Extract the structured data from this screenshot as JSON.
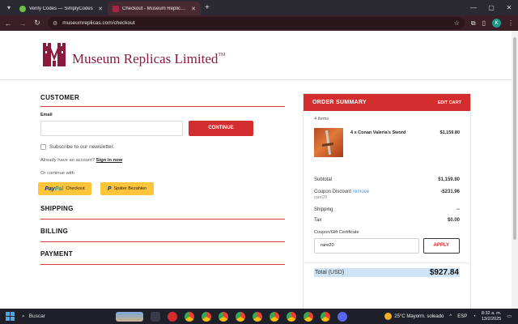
{
  "browser": {
    "tabs": [
      {
        "title": "Verify Codes — SimplyCodes",
        "active": false,
        "favicon_color": "#6cc24a"
      },
      {
        "title": "Checkout - Museum Replicas Li",
        "active": true,
        "favicon_color": "#a8243f"
      }
    ],
    "url": "museumreplicas.com/checkout",
    "profile_initial": "K"
  },
  "header": {
    "logo_text": "Museum Replicas Limited",
    "logo_tm": "TM"
  },
  "customer": {
    "title": "CUSTOMER",
    "email_label": "Email",
    "email_value": "",
    "continue_label": "CONTINUE",
    "newsletter_label": "Subscribe to our newsletter.",
    "account_prompt": "Already have an account?",
    "signin_label": "Sign in now",
    "or_continue": "Or continue with",
    "paypal_brand_a": "Pay",
    "paypal_brand_b": "Pal",
    "paypal_label": "Checkout",
    "paylater_label": "Später Bezahlen"
  },
  "sections": {
    "shipping": "SHIPPING",
    "billing": "BILLING",
    "payment": "PAYMENT"
  },
  "summary": {
    "title": "ORDER SUMMARY",
    "edit_label": "EDIT CART",
    "items_count": "4 Items",
    "item": {
      "name": "4 x Conan Valeria's Sword",
      "price": "$1,159.80"
    },
    "subtotal_label": "Subtotal",
    "subtotal_value": "$1,159.80",
    "coupon_label": "Coupon Discount",
    "coupon_remove": "remove",
    "coupon_value": "-$231.96",
    "coupon_code": "rare20",
    "shipping_label": "Shipping",
    "shipping_value": "--",
    "tax_label": "Tax",
    "tax_value": "$0.00",
    "coupon_gift_label": "Coupon/Gift Certificate",
    "coupon_input_value": "rare20",
    "apply_label": "APPLY",
    "total_label": "Total (USD)",
    "total_value": "$927.84"
  },
  "taskbar": {
    "search_label": "Buscar",
    "weather": "25°C  Mayorm. soleado",
    "lang": "ESP",
    "time": "8:32 a. m.",
    "date": "13/2/2025"
  },
  "colors": {
    "brand": "#8b1b3d",
    "accent_red": "#d42d2d"
  }
}
